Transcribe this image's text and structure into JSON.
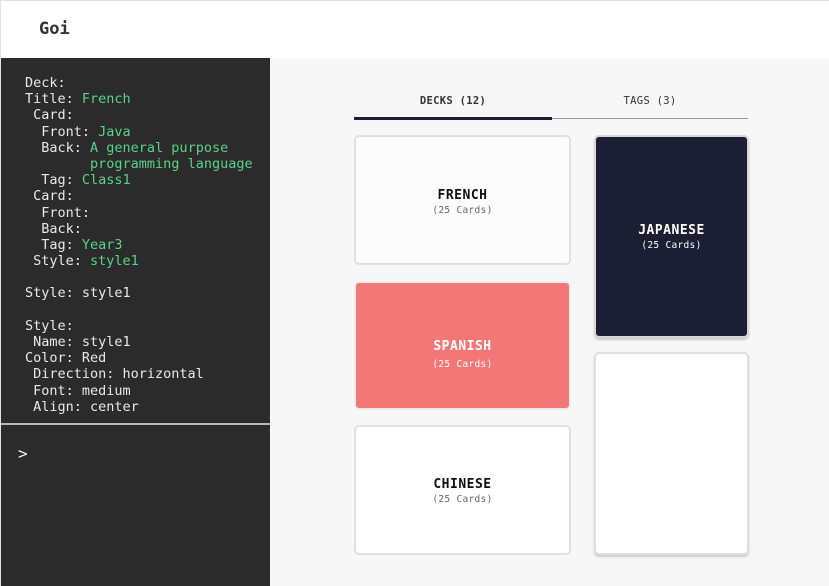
{
  "app": {
    "title": "Goi"
  },
  "editor": {
    "lines": [
      {
        "key": "Deck:",
        "value": ""
      },
      {
        "key": "Title: ",
        "value": "French"
      },
      {
        "key": " Card:",
        "value": ""
      },
      {
        "key": "  Front: ",
        "value": "Java"
      },
      {
        "key": "  Back: ",
        "value": "A general purpose"
      },
      {
        "key": "        ",
        "value": "programming language"
      },
      {
        "key": "  Tag: ",
        "value": "Class1"
      },
      {
        "key": " Card:",
        "value": ""
      },
      {
        "key": "  Front:",
        "value": ""
      },
      {
        "key": "  Back:",
        "value": ""
      },
      {
        "key": "  Tag: ",
        "value": "Year3"
      },
      {
        "key": " Style: ",
        "value": "style1"
      },
      {
        "key": "",
        "value": ""
      },
      {
        "key": "Style: style1",
        "value": ""
      },
      {
        "key": "",
        "value": ""
      },
      {
        "key": "Style:",
        "value": ""
      },
      {
        "key": " Name: style1",
        "value": ""
      },
      {
        "key": "Color: Red",
        "value": ""
      },
      {
        "key": " Direction: horizontal",
        "value": ""
      },
      {
        "key": " Font: medium",
        "value": ""
      },
      {
        "key": " Align: center",
        "value": ""
      }
    ]
  },
  "console": {
    "prompt": ">"
  },
  "tabs": {
    "decks": "DECKS (12)",
    "tags": "TAGS (3)",
    "active": "decks"
  },
  "decks": [
    {
      "name": "FRENCH",
      "count": "(25 Cards)",
      "color": "#fcfcfc"
    },
    {
      "name": "SPANISH",
      "count": "(25 Cards)",
      "color": "#f37777"
    },
    {
      "name": "CHINESE",
      "count": "(25 Cards)",
      "color": "#ffffff"
    },
    {
      "name": "JAPANESE",
      "count": "(25 Cards)",
      "color": "#1c1e34"
    }
  ],
  "colors": {
    "sidebar_bg": "#2b2b2b",
    "code_text": "#e8e8e8",
    "code_value": "#5ad28a",
    "tab_indicator": "#1c1e34"
  }
}
